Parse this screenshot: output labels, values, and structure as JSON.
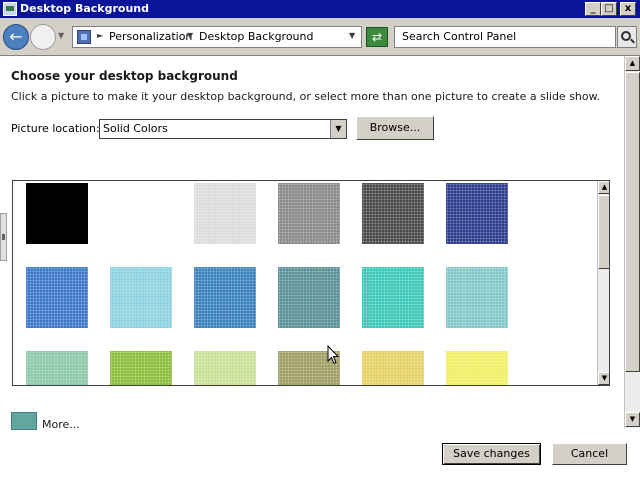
{
  "window": {
    "title": "Desktop Background",
    "min_label": "_",
    "max_label": "□",
    "close_label": "x"
  },
  "nav": {
    "back_icon": "back-arrow-icon",
    "forward_icon": "forward-arrow-icon"
  },
  "breadcrumb": {
    "items": [
      "Personalization",
      "Desktop Background"
    ]
  },
  "search": {
    "placeholder": "Search Control Panel"
  },
  "main": {
    "heading": "Choose your desktop background",
    "instructions": "Click a picture to make it your desktop background, or select more than one picture to create a slide show.",
    "picture_location_label": "Picture location:",
    "picture_location_value": "Solid Colors",
    "browse_label": "Browse..."
  },
  "swatches": [
    "#000000",
    "#ffffff",
    "#dcdcdc",
    "#8a8a8a",
    "#4a4a4a",
    "#2d3c8c",
    "#3c78c8",
    "#8cd2e0",
    "#3c82bc",
    "#5a9096",
    "#3cc8b8",
    "#82c8c8",
    "#8cc8aa",
    "#8cbe3c",
    "#c8e196",
    "#a0a064",
    "#e6d264",
    "#f0f064"
  ],
  "more": {
    "label": "More...",
    "swatch_color": "#5fa7a0"
  },
  "buttons": {
    "save": "Save changes",
    "cancel": "Cancel"
  },
  "colors": {
    "titlebar": "#0a1496",
    "chrome": "#d4d0c8"
  }
}
